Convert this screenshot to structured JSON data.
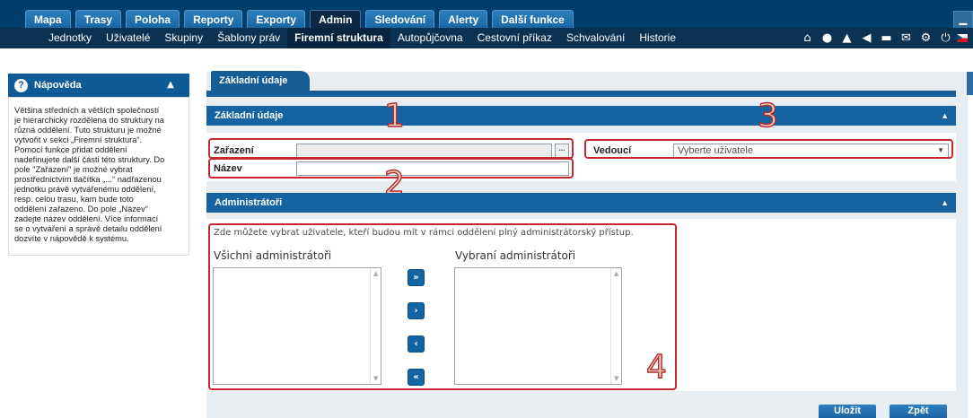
{
  "top_nav": {
    "tabs": [
      "Mapa",
      "Trasy",
      "Poloha",
      "Reporty",
      "Exporty",
      "Admin",
      "Sledování",
      "Alerty",
      "Další funkce"
    ],
    "active_tab": "Admin"
  },
  "sub_nav": {
    "items": [
      "Jednotky",
      "Uživatelé",
      "Skupiny",
      "Šablony práv",
      "Firemní struktura",
      "Autopůjčovna",
      "Cestovní příkaz",
      "Schvalování",
      "Historie"
    ],
    "active_item": "Firemní struktura",
    "icons": [
      "home-icon",
      "chat-icon",
      "alert-icon",
      "sound-icon",
      "folder-icon",
      "mail-icon",
      "settings-icon",
      "power-icon",
      "flag-icon"
    ]
  },
  "help": {
    "title": "Nápověda",
    "icon": "?",
    "lines": [
      "Většina středních a větších společností",
      "je hierarchicky rozdělena do struktury na",
      "různá oddělení. Tuto strukturu je možné",
      "vytvořit v sekci „Firemní struktura“.",
      "Pomocí funkce přidat oddělení",
      "nadefinujete další části této struktury. Do",
      "pole \"Zařazení\" je možné vybrat",
      "prostřednictvím tlačítka „...“ nadřazenou",
      "jednotku právě vytvářenému oddělení,",
      "resp. celou trasu, kam bude toto",
      "oddělení zařazeno. Do pole „Název“",
      "zadejte název oddělení. Více informací",
      "se o vytváření a správě detailu oddělení",
      "dozvíte v nápovědě k systému."
    ]
  },
  "main": {
    "tab_label": "Základní údaje",
    "basic_section": {
      "title": "Základní údaje",
      "zarazeni_label": "Zařazení",
      "zarazeni_value": "",
      "dots_label": "...",
      "nazev_label": "Název",
      "nazev_value": "",
      "vedouci_label": "Vedoucí",
      "vedouci_placeholder": "Vyberte uživatele"
    },
    "admin_section": {
      "title": "Administrátoři",
      "hint": "Zde můžete vybrat uživatele, kteří budou mít v rámci oddělení plný administrátorský přístup.",
      "all_admins_label": "Všichni administrátoři",
      "selected_admins_label": "Vybraní administrátoři",
      "all_admins": [],
      "selected_admins": []
    },
    "annotations": [
      "1",
      "2",
      "3",
      "4"
    ]
  },
  "footer": {
    "save_label": "Uložit",
    "back_label": "Zpět"
  },
  "colors": {
    "header_bg": "#003f6c",
    "section_header": "#1563a1",
    "annotation_red": "#c4292f"
  }
}
